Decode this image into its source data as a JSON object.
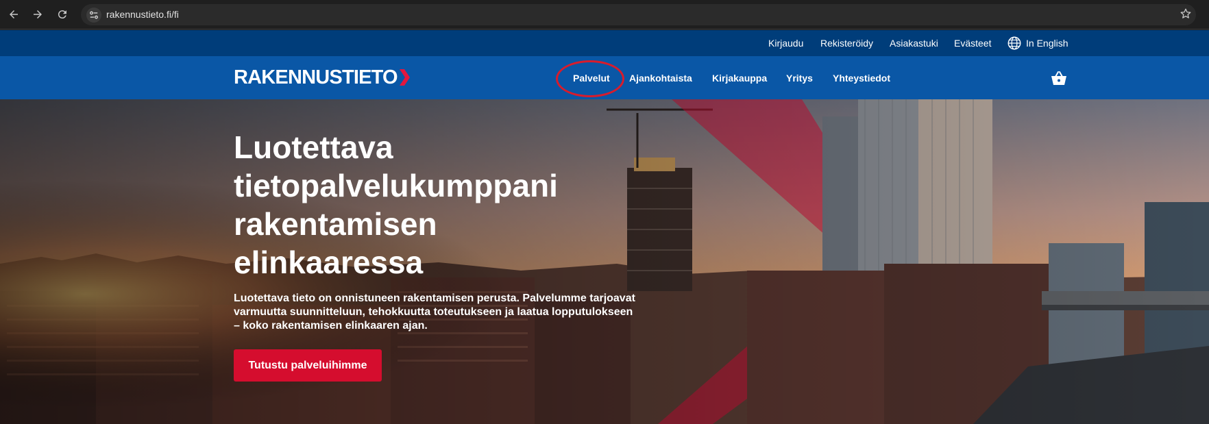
{
  "browser": {
    "url": "rakennustieto.fi/fi",
    "icons": {
      "back": "arrow-left-icon",
      "forward": "arrow-right-icon",
      "reload": "reload-icon",
      "site_info": "tune-icon",
      "bookmark": "star-icon"
    }
  },
  "utility_nav": {
    "login": "Kirjaudu",
    "register": "Rekisteröidy",
    "support": "Asiakastuki",
    "cookies": "Evästeet",
    "language": "In English"
  },
  "header": {
    "logo": "RAKENNUSTIETO",
    "nav": [
      "Palvelut",
      "Ajankohtaista",
      "Kirjakauppa",
      "Yritys",
      "Yhteystiedot"
    ],
    "highlighted_item": "Palvelut"
  },
  "hero": {
    "title_lines": [
      "Luotettava",
      "tietopalvelukumppani",
      "rakentamisen",
      "elinkaaressa"
    ],
    "desc_lines": [
      "Luotettava tieto on onnistuneen rakentamisen perusta. Palvelumme tarjoavat",
      "varmuutta suunnitteluun, tehokkuutta toteutukseen ja laatua lopputulokseen",
      "– koko rakentamisen elinkaaren ajan."
    ],
    "cta": "Tutustu palveluihimme"
  },
  "colors": {
    "chrome_bg": "#1f1f1f",
    "util_bar": "#003d7a",
    "header": "#0a57a6",
    "accent_red": "#d50d2e",
    "highlight_circle": "#d81c2c"
  }
}
